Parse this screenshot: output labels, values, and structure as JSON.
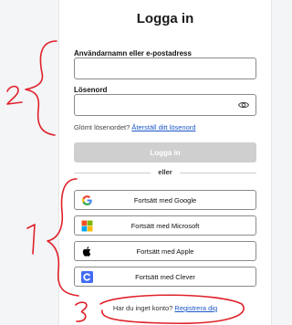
{
  "login": {
    "title": "Logga in",
    "username_label": "Användarnamn eller e-postadress",
    "username_value": "",
    "password_label": "Lösenord",
    "password_value": "",
    "forgot_prefix": "Glömt lösenordet?",
    "forgot_link": "Återställ ditt lösenord",
    "login_button": "Logga in",
    "divider_text": "eller",
    "sso": [
      {
        "label": "Fortsätt med Google",
        "icon": "google-icon"
      },
      {
        "label": "Fortsätt med Microsoft",
        "icon": "microsoft-icon"
      },
      {
        "label": "Fortsätt med Apple",
        "icon": "apple-icon"
      },
      {
        "label": "Fortsätt med Clever",
        "icon": "clever-icon"
      }
    ],
    "signup_prefix": "Har du inget konto?",
    "signup_link": "Registrera dig"
  },
  "annotations": {
    "mark_1": "1",
    "mark_2": "2",
    "mark_3": "3",
    "ink_color": "#e0202a"
  }
}
